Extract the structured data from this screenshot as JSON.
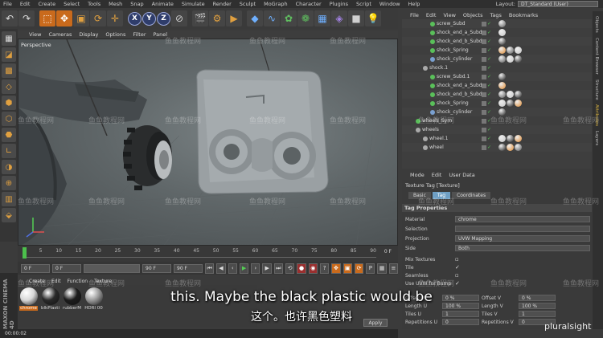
{
  "menubar": {
    "items": [
      "File",
      "Edit",
      "Create",
      "Select",
      "Tools",
      "Mesh",
      "Snap",
      "Animate",
      "Simulate",
      "Render",
      "Sculpt",
      "MoGraph",
      "Character",
      "Plugins",
      "Script",
      "Window",
      "Help"
    ],
    "layout_label": "Layout:",
    "layout_value": "DT_Standard (User)"
  },
  "toolbar": {
    "icons": [
      "undo-icon",
      "redo-icon",
      "live-selection-icon",
      "move-icon",
      "scale-icon",
      "rotate-icon",
      "last-tool-icon",
      "x-axis-icon",
      "y-axis-icon",
      "z-axis-icon",
      "coordinate-system-icon",
      "render-view-icon",
      "render-settings-icon",
      "render-to-picture-viewer-icon",
      "cube-icon",
      "bend-icon",
      "subdivision-icon",
      "array-icon",
      "floor-icon",
      "deformer-icon",
      "camera-icon",
      "light-icon"
    ],
    "x": "X",
    "y": "Y",
    "z": "Z"
  },
  "viewport": {
    "menu": [
      "View",
      "Cameras",
      "Display",
      "Options",
      "Filter",
      "Panel"
    ],
    "label": "Perspective"
  },
  "timeline": {
    "ticks": [
      "0",
      "5",
      "10",
      "15",
      "20",
      "25",
      "30",
      "35",
      "40",
      "45",
      "50",
      "55",
      "60",
      "65",
      "70",
      "75",
      "80",
      "85",
      "90"
    ],
    "end_label": "0 F",
    "start_field": "0 F",
    "current_field": "0 F",
    "max_field": "90 F",
    "end_field": "90 F"
  },
  "material_manager": {
    "menu": [
      "Create",
      "Edit",
      "Function",
      "Texture"
    ],
    "materials": [
      {
        "name": "chrome",
        "color": "#d8d8d8"
      },
      {
        "name": "blkPlasti",
        "color": "#2a2a2a"
      },
      {
        "name": "rubberM",
        "color": "#1c1c1c"
      },
      {
        "name": "HDRI 00",
        "color": "#9a9a9a"
      }
    ]
  },
  "status": {
    "time": "00:00:02"
  },
  "brand_vertical": "MAXON CINEMA 4D",
  "object_manager": {
    "menu": [
      "File",
      "Edit",
      "View",
      "Objects",
      "Tags",
      "Bookmarks"
    ],
    "rows": [
      {
        "name": "screw_Subd",
        "indent": 3,
        "icon": "#5ac05a"
      },
      {
        "name": "shock_end_a_Subd",
        "indent": 3,
        "icon": "#5ac05a"
      },
      {
        "name": "shock_end_b_Subd",
        "indent": 3,
        "icon": "#5ac05a"
      },
      {
        "name": "shock_Spring",
        "indent": 3,
        "icon": "#5ac05a"
      },
      {
        "name": "shock_cylinder",
        "indent": 3,
        "icon": "#7aa0d0"
      },
      {
        "name": "shock.1",
        "indent": 2,
        "icon": "#aaaaaa"
      },
      {
        "name": "screw_Subd.1",
        "indent": 3,
        "icon": "#5ac05a"
      },
      {
        "name": "shock_end_a_Subd",
        "indent": 3,
        "icon": "#5ac05a"
      },
      {
        "name": "shock_end_b_Subd",
        "indent": 3,
        "icon": "#5ac05a"
      },
      {
        "name": "shock_Spring",
        "indent": 3,
        "icon": "#5ac05a"
      },
      {
        "name": "shock_cylinder",
        "indent": 3,
        "icon": "#7aa0d0"
      },
      {
        "name": "wheels_Sym",
        "indent": 1,
        "icon": "#5ac05a"
      },
      {
        "name": "wheels",
        "indent": 1,
        "icon": "#aaaaaa"
      },
      {
        "name": "wheel.1",
        "indent": 2,
        "icon": "#aaaaaa"
      },
      {
        "name": "wheel",
        "indent": 2,
        "icon": "#aaaaaa"
      }
    ]
  },
  "attribute_manager": {
    "menu": [
      "Mode",
      "Edit",
      "User Data"
    ],
    "title": "Texture Tag [Texture]",
    "tabs": [
      "Basic",
      "Tag",
      "Coordinates"
    ],
    "active_tab": "Tag",
    "section": "Tag Properties",
    "properties": [
      {
        "label": "Material",
        "value": "chrome"
      },
      {
        "label": "Selection",
        "value": ""
      },
      {
        "label": "Projection",
        "value": "UVW Mapping"
      },
      {
        "label": "Side",
        "value": "Both"
      }
    ],
    "checks": [
      {
        "label": "Mix Textures",
        "checked": false
      },
      {
        "label": "Tile",
        "checked": true
      },
      {
        "label": "Seamless",
        "checked": false
      },
      {
        "label": "Use UVW for Bump",
        "checked": true
      }
    ],
    "offset": [
      {
        "label": "Offset U",
        "value": "0 %"
      },
      {
        "label": "Offset V",
        "value": "0 %"
      },
      {
        "label": "Length U",
        "value": "100 %"
      },
      {
        "label": "Length V",
        "value": "100 %"
      },
      {
        "label": "Tiles U",
        "value": "1"
      },
      {
        "label": "Tiles V",
        "value": "1"
      },
      {
        "label": "Repetitions U",
        "value": "0"
      },
      {
        "label": "Repetitions V",
        "value": "0"
      }
    ],
    "apply": "Apply"
  },
  "side_tabs": [
    "Objects",
    "Content Browser",
    "Structure",
    "Attributes",
    "Layers"
  ],
  "subtitles": {
    "en": "this. Maybe the black plastic would be",
    "zh": "这个。也许黑色塑料"
  },
  "brand": "pluralsight",
  "watermark": "鱼鱼教程网"
}
